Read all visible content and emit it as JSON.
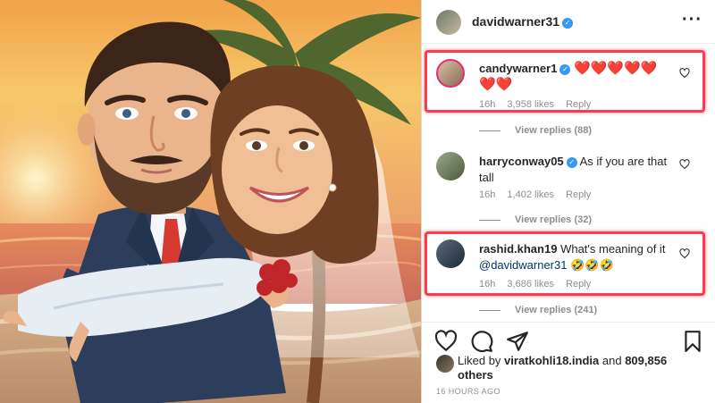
{
  "post": {
    "author": "davidwarner31",
    "liked_by_user": "viratkohli18.india",
    "liked_by_prefix": "Liked by",
    "liked_by_and": "and",
    "liked_by_others": "809,856 others",
    "time_ago": "16 HOURS AGO"
  },
  "comments": [
    {
      "username": "candywarner1",
      "verified": true,
      "text": "❤️❤️❤️❤️❤️❤️❤️",
      "time": "16h",
      "likes": "3,958 likes",
      "reply": "Reply",
      "view_replies": "View replies (88)",
      "highlighted": true
    },
    {
      "username": "harryconway05",
      "verified": true,
      "text": "As if you are that tall",
      "time": "16h",
      "likes": "1,402 likes",
      "reply": "Reply",
      "view_replies": "View replies (32)",
      "highlighted": false
    },
    {
      "username": "rashid.khan19",
      "verified": false,
      "text_before": "What's meaning of it",
      "mention": "@davidwarner31",
      "emoji": "🤣🤣🤣",
      "time": "16h",
      "likes": "3,686 likes",
      "reply": "Reply",
      "view_replies": "View replies (241)",
      "highlighted": true
    }
  ],
  "colors": {
    "verified": "#3897f0",
    "highlight_border": "#ff3a4a",
    "heart": "#ed1c24",
    "meta_gray": "#8e8e8e"
  },
  "icons": [
    "heart-icon",
    "comment-icon",
    "share-icon",
    "bookmark-icon",
    "more-options-icon",
    "verified-badge-icon"
  ]
}
